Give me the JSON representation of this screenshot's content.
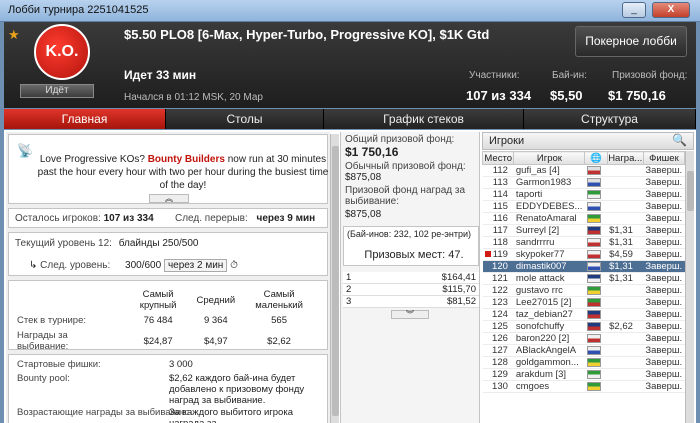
{
  "window": {
    "title": "Лобби турнира 2251041525"
  },
  "header": {
    "logo_text": "K.O.",
    "status": "Идёт",
    "title": "$5.50 PLO8 [6-Max, Hyper-Turbo, Progressive KO], $1K Gtd",
    "lobby_button": "Покерное лобби",
    "time_running": "Идет 33 мин",
    "started": "Начался в 01:12 MSK, 20 Мар",
    "participants_label": "Участники:",
    "participants_value": "107 из 334",
    "buyin_label": "Бай-ин:",
    "buyin_value": "$5,50",
    "prizepool_label": "Призовой фонд:",
    "prizepool_value": "$1 750,16"
  },
  "tabs": [
    {
      "label": "Главная",
      "active": true
    },
    {
      "label": "Столы",
      "active": false
    },
    {
      "label": "График стеков",
      "active": false
    },
    {
      "label": "Структура",
      "active": false
    }
  ],
  "promo": {
    "text_before": "Love Progressive KOs? ",
    "link": "Bounty Builders",
    "text_after": " now run at 30 minutes past the hour every hour with two per hour during the busiest time of the day!"
  },
  "status": {
    "left_label": "Осталось игроков:",
    "left_value": "107 из 334",
    "break_label": "След. перерыв:",
    "break_value": "через 9 мин"
  },
  "level": {
    "current_label": "Текущий уровень 12:",
    "current_value": "блайнды 250/500",
    "next_label": "След. уровень:",
    "next_value": "300/600",
    "next_time": "через 2 мин"
  },
  "stacks": {
    "headers": [
      "",
      "Самый крупный",
      "Средний",
      "Самый маленький"
    ],
    "rows": [
      {
        "label": "Стек в турнире:",
        "values": [
          "76 484",
          "9 364",
          "565"
        ]
      },
      {
        "label": "Награды за выбивание:",
        "values": [
          "$24,87",
          "$4,97",
          "$2,62"
        ]
      }
    ]
  },
  "info": [
    {
      "label": "Стартовые фишки:",
      "value": "3 000"
    },
    {
      "label": "Bounty pool:",
      "value": "$2,62 каждого бай-ина будет добавлено к призовому фонду наград за выбивание."
    },
    {
      "label": "Возрастающие награды за выбивание:",
      "value": "За каждого выбитого игрока награда за"
    }
  ],
  "prize": {
    "total_label": "Общий призовой фонд:",
    "total_value": "$1 750,16",
    "regular_label": "Обычный призовой фонд:",
    "regular_value": "$875,08",
    "bounty_label": "Призовой фонд наград за выбивание:",
    "bounty_value": "$875,08",
    "buyins_note": "(Бай-инов: 232, 102 ре-энтри)",
    "places_paid": "Призовых мест: 47.",
    "places": [
      {
        "place": "1",
        "amount": "$164,41"
      },
      {
        "place": "2",
        "amount": "$115,70"
      },
      {
        "place": "3",
        "amount": "$81,52"
      }
    ]
  },
  "players": {
    "title": "Игроки",
    "columns": [
      "Место",
      "Игрок",
      "",
      "Награ...",
      "Фишек"
    ],
    "rows": [
      {
        "place": "112",
        "name": "gufi_as [4]",
        "award": "",
        "chips": "Заверш.",
        "flag_colors": [
          "#e0e0e0",
          "#c03030"
        ]
      },
      {
        "place": "113",
        "name": "Garmon1983",
        "award": "",
        "chips": "Заверш.",
        "flag_colors": [
          "#e0e0e0",
          "#3050b0"
        ]
      },
      {
        "place": "114",
        "name": "taporti",
        "award": "",
        "chips": "Заверш.",
        "flag_colors": [
          "#2f9a3a",
          "#f0f0f0"
        ]
      },
      {
        "place": "115",
        "name": "EDDYDEBES...",
        "award": "",
        "chips": "Заверш.",
        "flag_colors": [
          "#f0f0f0",
          "#3050b0"
        ]
      },
      {
        "place": "116",
        "name": "RenatoAmaral",
        "award": "",
        "chips": "Заверш.",
        "flag_colors": [
          "#2f9a3a",
          "#f0d030"
        ]
      },
      {
        "place": "117",
        "name": "Surreyl [2]",
        "award": "$1,31",
        "chips": "Заверш.",
        "flag_colors": [
          "#203a80",
          "#c03030"
        ]
      },
      {
        "place": "118",
        "name": "sandrrrru",
        "award": "$1,31",
        "chips": "Заверш.",
        "flag_colors": [
          "#f0f0f0",
          "#c03030"
        ]
      },
      {
        "place": "119",
        "name": "skypoker77",
        "award": "$4,59",
        "chips": "Заверш.",
        "flag_colors": [
          "#f0f0f0",
          "#c03030"
        ],
        "marked": true
      },
      {
        "place": "120",
        "name": "dimastik007",
        "award": "$1,31",
        "chips": "Заверш.",
        "flag_colors": [
          "#f0f0f0",
          "#3050b0"
        ],
        "selected": true
      },
      {
        "place": "121",
        "name": "mole attack",
        "award": "$1,31",
        "chips": "Заверш.",
        "flag_colors": [
          "#203a80",
          "#f0f0f0"
        ]
      },
      {
        "place": "122",
        "name": "gustavo rrc",
        "award": "",
        "chips": "Заверш.",
        "flag_colors": [
          "#2f9a3a",
          "#f0d030"
        ]
      },
      {
        "place": "123",
        "name": "Lee27015 [2]",
        "award": "",
        "chips": "Заверш.",
        "flag_colors": [
          "#2f9a3a",
          "#c03030"
        ]
      },
      {
        "place": "124",
        "name": "taz_debian27",
        "award": "",
        "chips": "Заверш.",
        "flag_colors": [
          "#203a80",
          "#c03030"
        ]
      },
      {
        "place": "125",
        "name": "sonofchuffy",
        "award": "$2,62",
        "chips": "Заверш.",
        "flag_colors": [
          "#203a80",
          "#c03030"
        ]
      },
      {
        "place": "126",
        "name": "baron220 [2]",
        "award": "",
        "chips": "Заверш.",
        "flag_colors": [
          "#f0f0f0",
          "#c03030"
        ]
      },
      {
        "place": "127",
        "name": "ABlackAngelA",
        "award": "",
        "chips": "Заверш.",
        "flag_colors": [
          "#f0f0f0",
          "#3050b0"
        ]
      },
      {
        "place": "128",
        "name": "goldgammon...",
        "award": "",
        "chips": "Заверш.",
        "flag_colors": [
          "#2f9a3a",
          "#f0d030"
        ]
      },
      {
        "place": "129",
        "name": "arakdum [3]",
        "award": "",
        "chips": "Заверш.",
        "flag_colors": [
          "#2f9a3a",
          "#f0f0f0"
        ]
      },
      {
        "place": "130",
        "name": "cmgoes",
        "award": "",
        "chips": "Заверш.",
        "flag_colors": [
          "#2f9a3a",
          "#f0d030"
        ]
      }
    ]
  }
}
